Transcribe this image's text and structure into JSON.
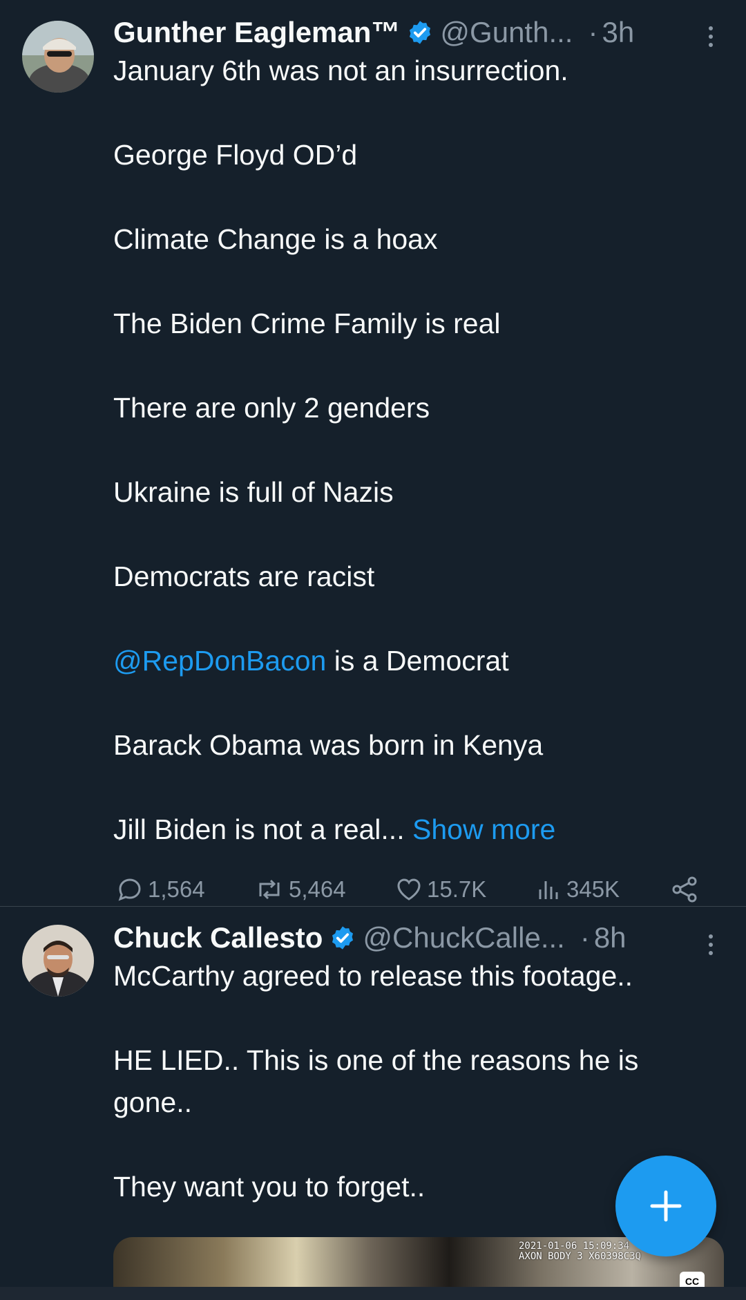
{
  "tweets": [
    {
      "author_name": "Gunther Eagleman™",
      "handle": "@Gunth...",
      "separator": "·",
      "time": "3h",
      "lines": [
        "January 6th was not an insurrection.",
        "George Floyd OD’d",
        "Climate Change is a hoax",
        "The Biden Crime Family is real",
        "There are only 2 genders",
        "Ukraine is full of Nazis",
        "Democrats are racist"
      ],
      "mention": "@RepDonBacon",
      "mention_suffix": " is a Democrat",
      "line_after_mention": "Barack Obama was born in Kenya",
      "truncated_line": "Jill Biden is not a real...",
      "show_more": "Show more",
      "replies": "1,564",
      "reposts": "5,464",
      "likes": "15.7K",
      "views": "345K"
    },
    {
      "author_name": "Chuck Callesto",
      "handle": "@ChuckCalle...",
      "separator": "·",
      "time": "8h",
      "lines": [
        "McCarthy agreed to release this footage..",
        "HE LIED.. This is one of the reasons he is",
        "gone..",
        "They want you to forget.."
      ],
      "media_overlay_line1": "2021-01-06 15:09:34",
      "media_overlay_line2": "AXON BODY 3 X60398C3Q",
      "cc_label": "CC"
    }
  ],
  "colors": {
    "background": "#15202b",
    "text": "#f7f9f9",
    "secondary": "#8b98a5",
    "accent": "#1d9bf0",
    "divider": "#38444d"
  },
  "icons": {
    "verified": "verified-badge-icon",
    "more": "more-vertical-icon",
    "reply": "reply-icon",
    "repost": "repost-icon",
    "like": "heart-icon",
    "views": "views-bar-chart-icon",
    "share": "share-icon",
    "compose": "plus-icon"
  }
}
